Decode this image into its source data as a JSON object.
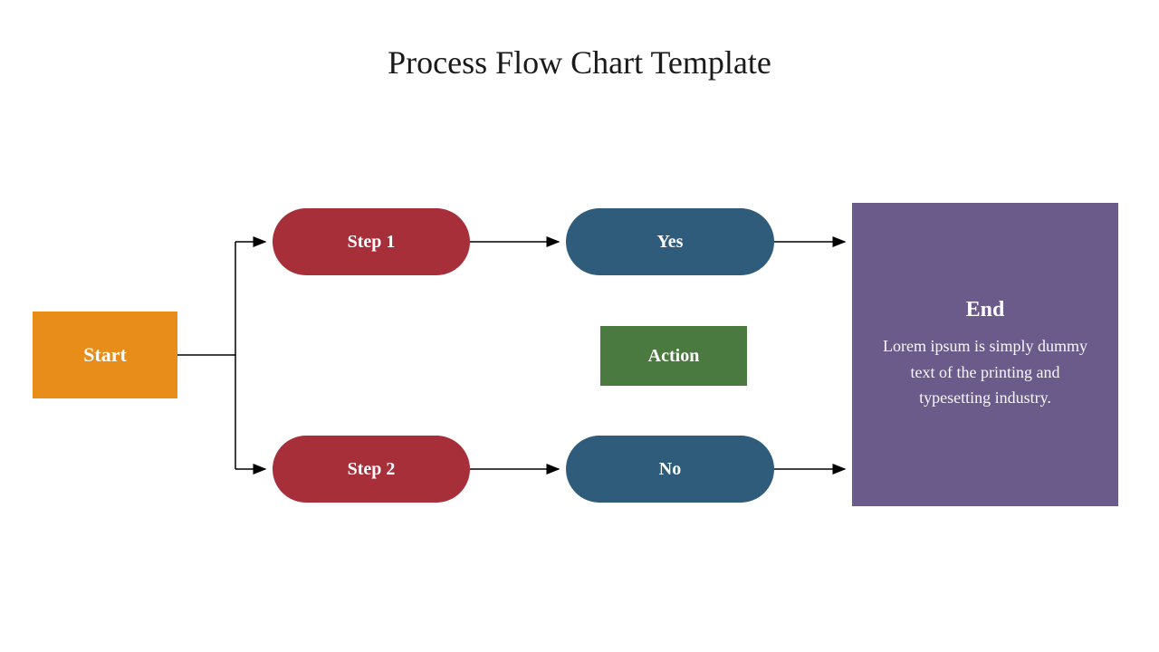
{
  "title": "Process Flow Chart Template",
  "nodes": {
    "start": {
      "label": "Start",
      "color": "#e88c1a"
    },
    "step1": {
      "label": "Step 1",
      "color": "#a72f3a"
    },
    "step2": {
      "label": "Step 2",
      "color": "#a72f3a"
    },
    "yes": {
      "label": "Yes",
      "color": "#2e5c7a"
    },
    "no": {
      "label": "No",
      "color": "#2e5c7a"
    },
    "action": {
      "label": "Action",
      "color": "#4a7a3f"
    },
    "end": {
      "title": "End",
      "description": "Lorem ipsum is simply dummy text of the printing and typesetting industry.",
      "color": "#6b5b8a"
    }
  },
  "arrow_color": "#000000"
}
